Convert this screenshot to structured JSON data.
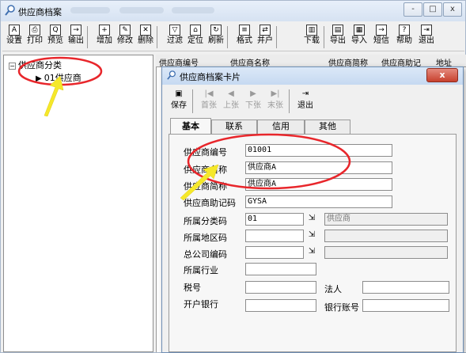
{
  "window": {
    "title": "供应商档案",
    "controls": [
      "-",
      "□",
      "x"
    ]
  },
  "toolbar": [
    {
      "label": "设置",
      "glyph": "A"
    },
    {
      "label": "打印",
      "glyph": "⎙"
    },
    {
      "label": "预览",
      "glyph": "Q"
    },
    {
      "label": "输出",
      "glyph": "→"
    },
    {
      "label": "增加",
      "glyph": "+"
    },
    {
      "label": "修改",
      "glyph": "✎"
    },
    {
      "label": "删除",
      "glyph": "✕"
    },
    {
      "label": "过滤",
      "glyph": "▽"
    },
    {
      "label": "定位",
      "glyph": "⌂"
    },
    {
      "label": "刷新",
      "glyph": "↻"
    },
    {
      "label": "格式",
      "glyph": "≡"
    },
    {
      "label": "并户",
      "glyph": "⇄"
    },
    {
      "label": "下载",
      "glyph": "▥"
    },
    {
      "label": "导出",
      "glyph": "▤"
    },
    {
      "label": "导入",
      "glyph": "▦"
    },
    {
      "label": "短信",
      "glyph": "→"
    },
    {
      "label": "帮助",
      "glyph": "?"
    },
    {
      "label": "退出",
      "glyph": "⇥"
    }
  ],
  "tree": {
    "root_label": "供应商分类",
    "root_expander": "−",
    "child_label": "01供应商",
    "child_marker": "▶"
  },
  "grid": {
    "columns": [
      "供应商编号",
      "供应商名称",
      "供应商简称",
      "供应商助记",
      "地址"
    ]
  },
  "dialog": {
    "title": "供应商档案卡片",
    "close": "x",
    "toolbar": [
      {
        "label": "保存",
        "glyph": "▣",
        "enabled": true
      },
      {
        "label": "首张",
        "glyph": "|◀",
        "enabled": false
      },
      {
        "label": "上张",
        "glyph": "◀",
        "enabled": false
      },
      {
        "label": "下张",
        "glyph": "▶",
        "enabled": false
      },
      {
        "label": "末张",
        "glyph": "▶|",
        "enabled": false
      },
      {
        "label": "退出",
        "glyph": "⇥",
        "enabled": true
      }
    ],
    "tabs": [
      "基本",
      "联系",
      "信用",
      "其他"
    ],
    "active_tab": "基本",
    "fields": {
      "code_label": "供应商编号",
      "code_value": "01001",
      "name_label": "供应商名称",
      "name_value": "供应商A",
      "short_label": "供应商简称",
      "short_value": "供应商A",
      "mnemonic_label": "供应商助记码",
      "mnemonic_value": "GYSA",
      "category_label": "所属分类码",
      "category_value": "01",
      "category_name": "供应商",
      "region_label": "所属地区码",
      "region_value": "",
      "parent_label": "总公司编码",
      "parent_value": "",
      "industry_label": "所属行业",
      "industry_value": "",
      "tax_label": "税号",
      "tax_value": "",
      "legal_label": "法人",
      "legal_value": "",
      "bank_label": "开户银行",
      "bank_value": "",
      "account_label": "银行账号",
      "account_value": "",
      "ref_glyph": "⇲"
    }
  },
  "annotations": {
    "circle_color": "#e8262b",
    "arrow_color": "#f5e82a"
  }
}
